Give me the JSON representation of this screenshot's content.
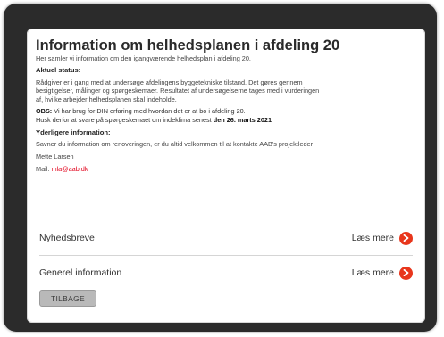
{
  "page": {
    "title": "Information om helhedsplanen i afdeling 20",
    "subtitle": "Her samler vi information om den igangværende helhedsplan i afdeling 20."
  },
  "status": {
    "heading": "Aktuel status:",
    "lines": [
      "Rådgiver er i gang med at undersøge afdelingens byggetekniske tilstand. Det gøres gennem",
      "besigtigelser, målinger og spørgeskemaer. Resultatet af undersøgelserne tages med i vurderingen",
      "af, hvilke arbejder helhedsplanen skal indeholde."
    ],
    "obs_label": "OBS:",
    "obs_text": " Vi har brug for DIN erfaring med hvordan det er at bo i afdeling 20.",
    "reminder_text": "Husk derfor at svare på spørgeskemaet om indeklima senest ",
    "deadline": "den 26. marts 2021"
  },
  "more_info": {
    "heading": "Yderligere information:",
    "text": "Savner du information om renoveringen, er du altid velkommen til at kontakte AAB's projektleder",
    "contact_name": "Mette Larsen",
    "mail_label": "Mail: ",
    "mail": "mla@aab.dk"
  },
  "links": [
    {
      "label": "Nyhedsbreve",
      "action": "Læs mere"
    },
    {
      "label": "Generel information",
      "action": "Læs mere"
    }
  ],
  "back_button": "TILBAGE",
  "colors": {
    "accent": "#e8361c",
    "link": "#e2001a",
    "frame": "#2b2b2b"
  }
}
